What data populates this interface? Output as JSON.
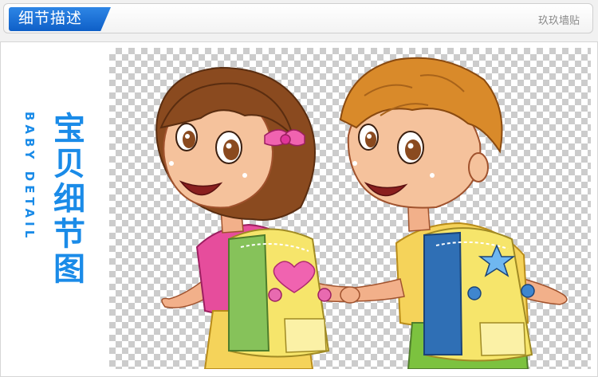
{
  "header": {
    "tab_title": "细节描述",
    "right_label": "玖玖墙贴"
  },
  "side_title": {
    "chinese": [
      "宝",
      "贝",
      "细",
      "节",
      "图"
    ],
    "english": "BABY DETAIL"
  },
  "colors": {
    "accent": "#1a8be8",
    "tab_blue": "#0e5fc7"
  }
}
